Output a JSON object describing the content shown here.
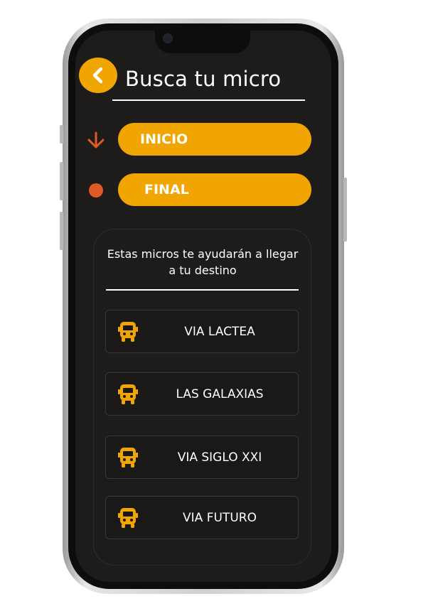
{
  "header": {
    "back_icon": "chevron-left-icon",
    "title": "Busca tu micro"
  },
  "search": {
    "start_icon": "arrow-down-icon",
    "start_label": "INICIO",
    "end_icon": "dot-icon",
    "end_label": "FINAL"
  },
  "results": {
    "message": "Estas micros te ayudarán a llegar a tu destino",
    "route_icon": "bus-icon",
    "routes": [
      {
        "name": "VIA LACTEA"
      },
      {
        "name": "LAS GALAXIAS"
      },
      {
        "name": "VIA SIGLO XXI"
      },
      {
        "name": "VIA FUTURO"
      }
    ]
  },
  "colors": {
    "accent": "#f0a500",
    "marker": "#e05a26",
    "background": "#1e1c1b"
  }
}
